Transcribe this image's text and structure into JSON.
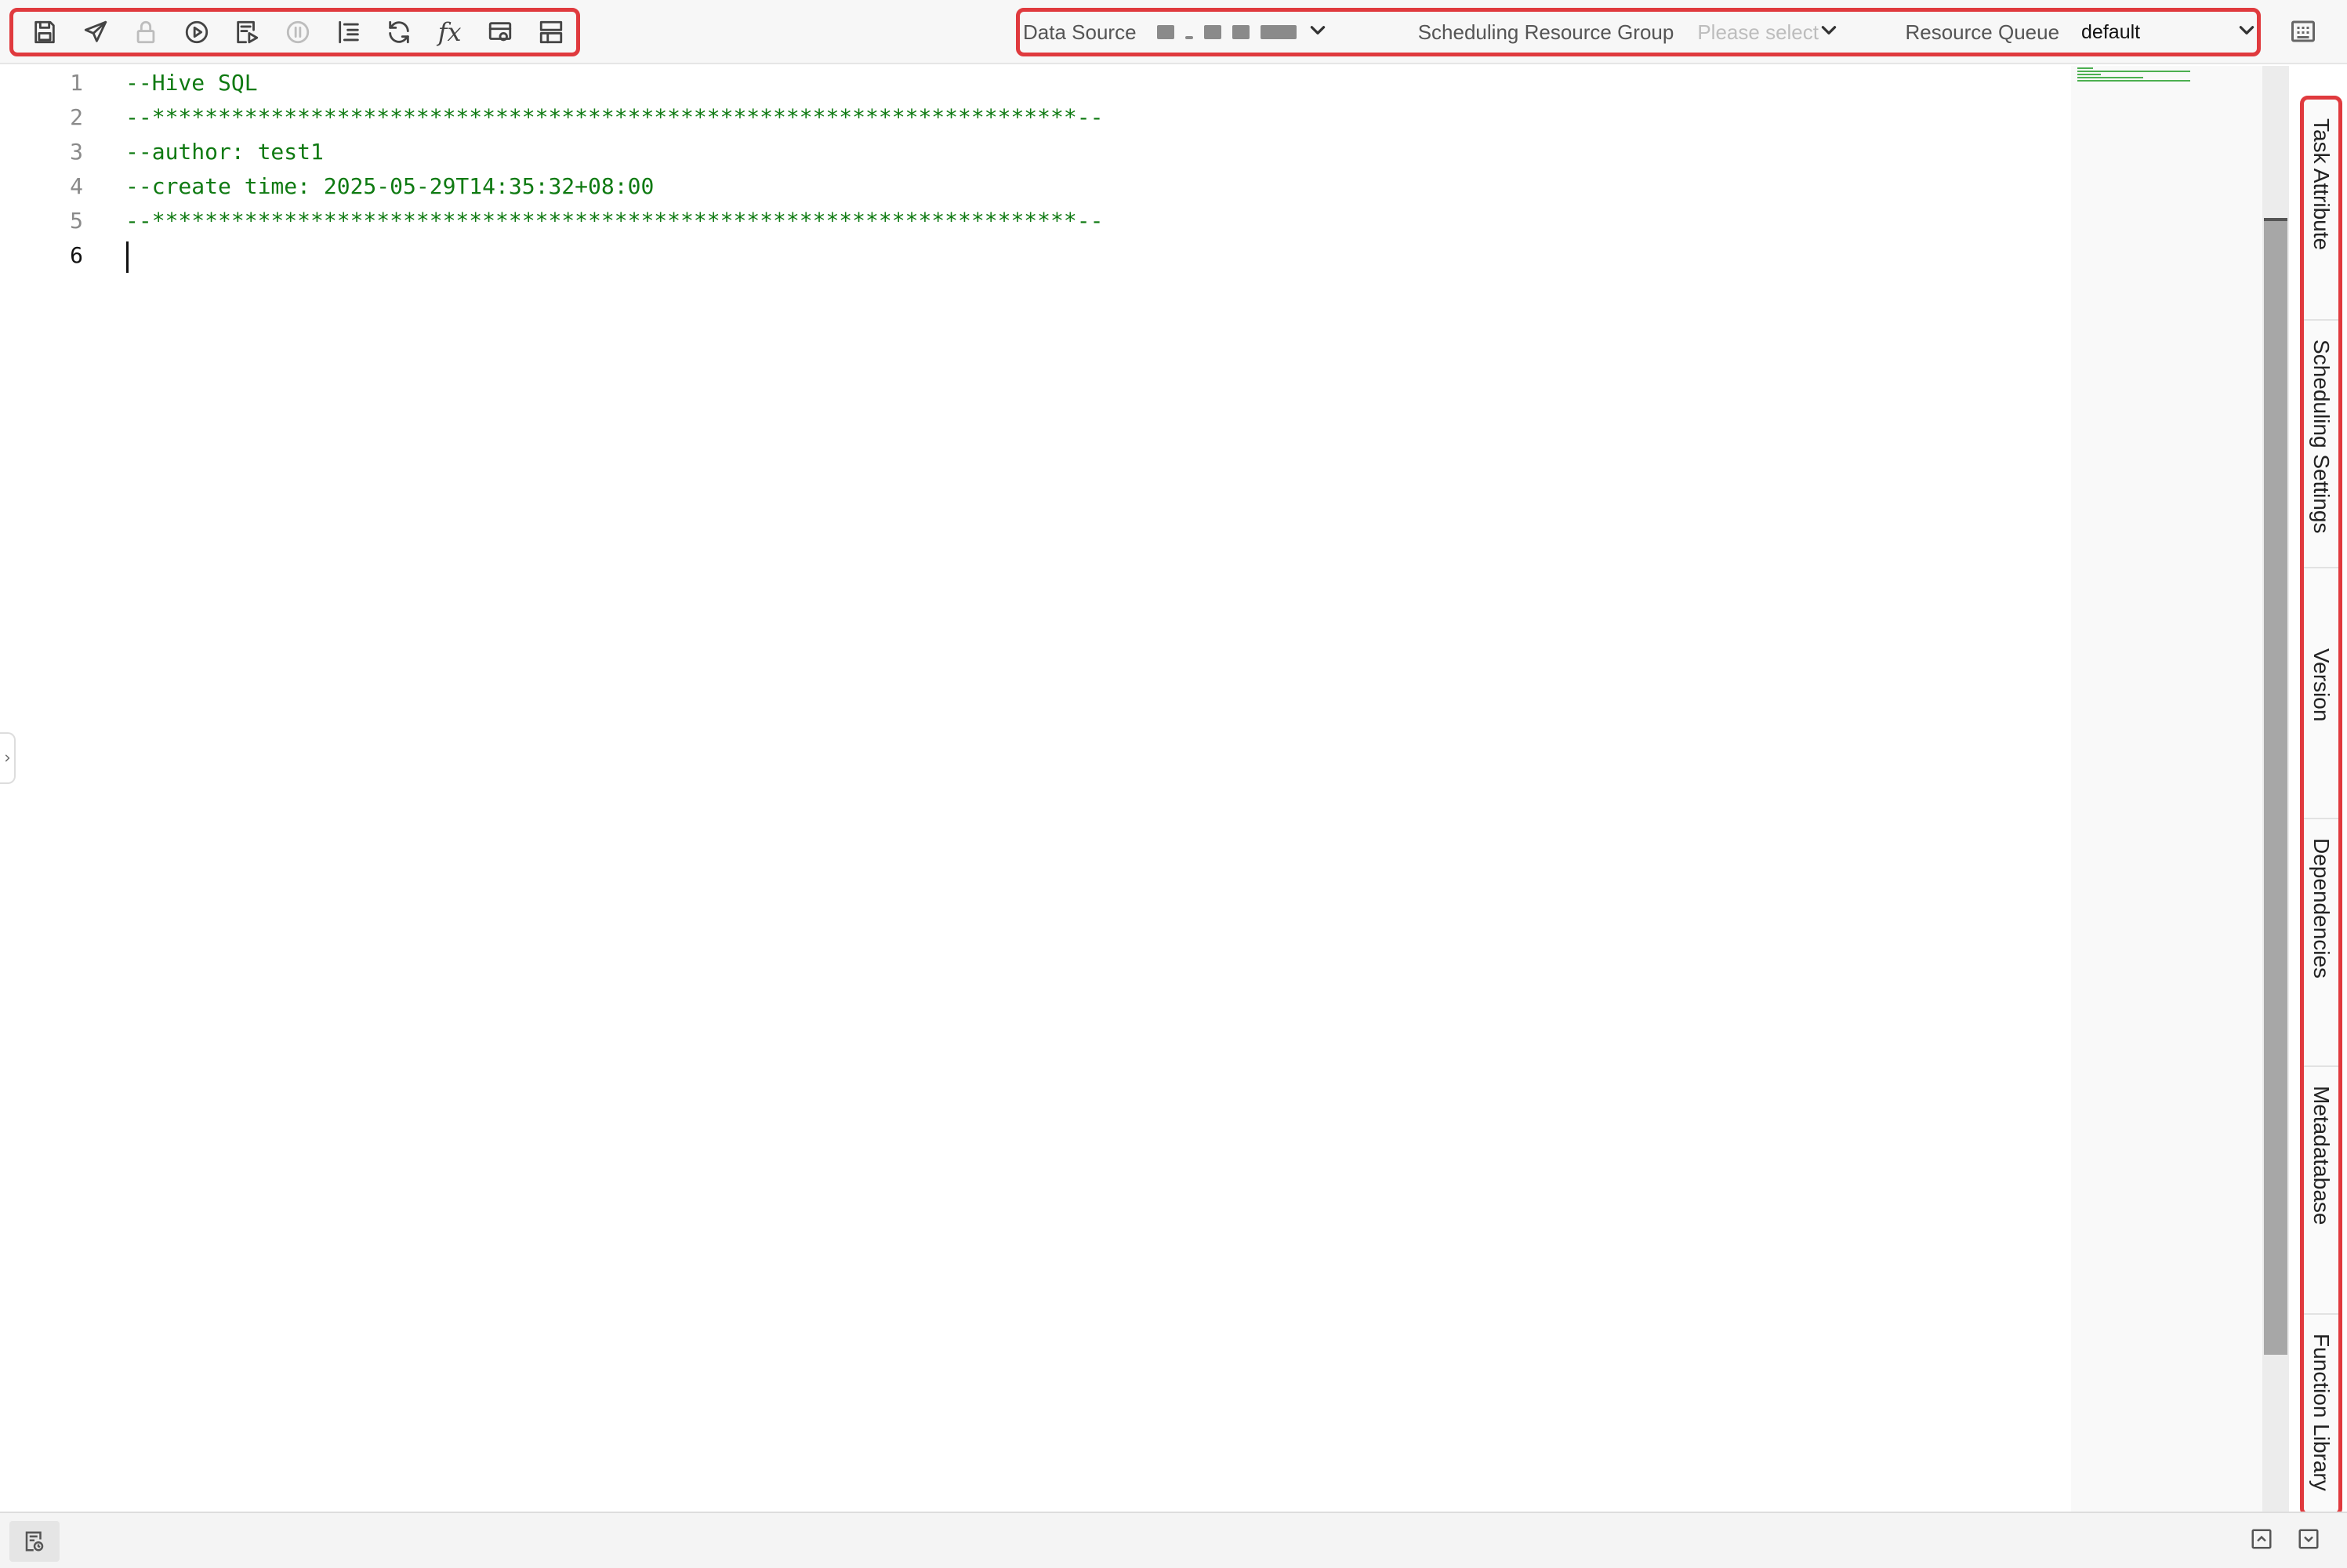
{
  "toolbar": {
    "icons": [
      "save-icon",
      "submit-icon",
      "lock-icon",
      "run-icon",
      "run-step-icon",
      "stop-icon",
      "format-icon",
      "refresh-icon",
      "function-icon",
      "params-icon",
      "layout-icon"
    ],
    "function_symbol": "fx"
  },
  "config": {
    "data_source_label": "Data Source",
    "scheduling_resource_group_label": "Scheduling Resource Group",
    "scheduling_resource_group_placeholder": "Please select",
    "resource_queue_label": "Resource Queue",
    "resource_queue_value": "default"
  },
  "editor": {
    "lines": [
      {
        "number": "1",
        "text": "--Hive SQL"
      },
      {
        "number": "2",
        "text": "--**********************************************************************--"
      },
      {
        "number": "3",
        "text": "--author: test1"
      },
      {
        "number": "4",
        "text": "--create time: 2025-05-29T14:35:32+08:00"
      },
      {
        "number": "5",
        "text": "--**********************************************************************--"
      },
      {
        "number": "6",
        "text": ""
      }
    ],
    "active_line": "6"
  },
  "side_tabs": [
    {
      "label": "Task Attribute"
    },
    {
      "label": "Scheduling Settings"
    },
    {
      "label": "Version"
    },
    {
      "label": "Dependencies"
    },
    {
      "label": "Metadatabase"
    },
    {
      "label": "Function Library"
    }
  ],
  "colors": {
    "highlight_border": "#e03a3e",
    "comment_text": "#0f7a12"
  }
}
